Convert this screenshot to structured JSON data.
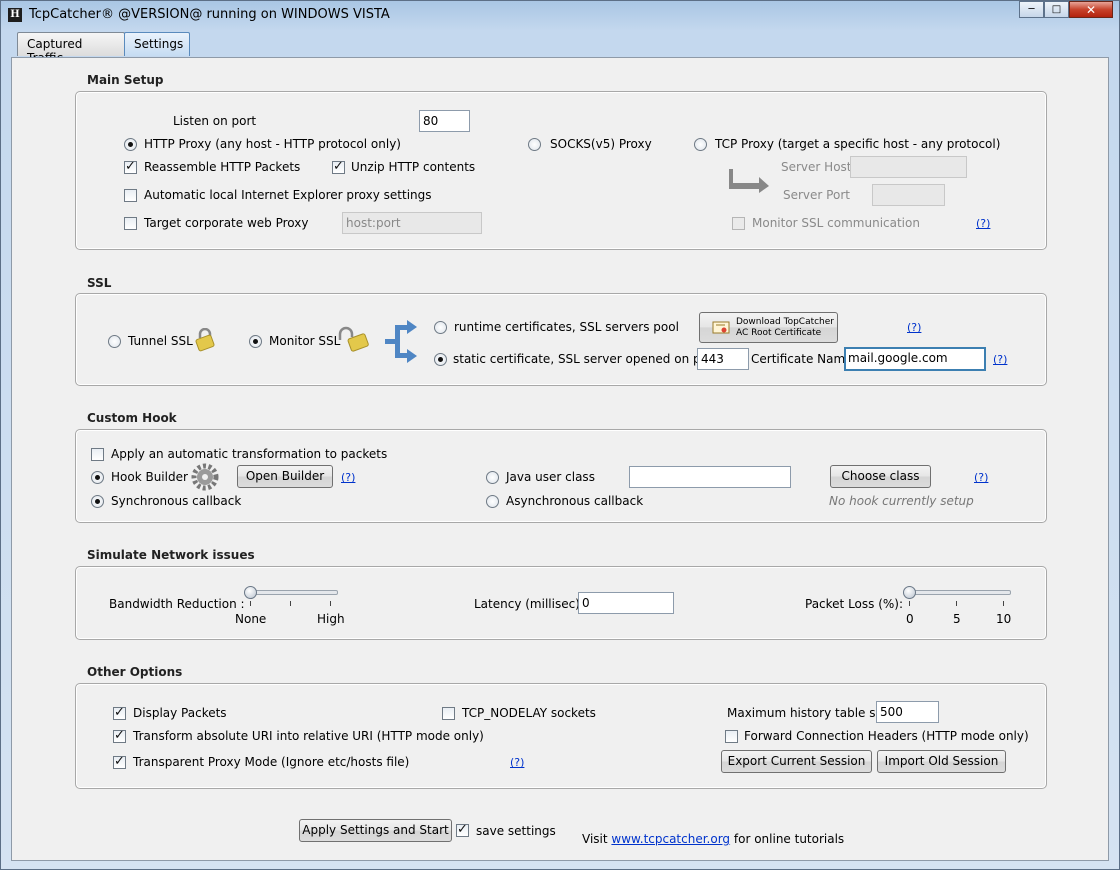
{
  "window": {
    "title": "TcpCatcher®  @VERSION@ running on WINDOWS VISTA"
  },
  "tabs": [
    {
      "label": "Captured Traffic"
    },
    {
      "label": "Settings"
    }
  ],
  "main_setup": {
    "title": "Main Setup",
    "listen_port_label": "Listen on port",
    "listen_port_value": "80",
    "http_proxy_label": "HTTP Proxy (any host - HTTP protocol only)",
    "socks_label": "SOCKS(v5) Proxy",
    "tcp_proxy_label": "TCP Proxy (target a specific host - any protocol)",
    "reassemble_label": "Reassemble HTTP Packets",
    "unzip_label": "Unzip HTTP contents",
    "auto_ie_label": "Automatic local Internet Explorer proxy settings",
    "target_proxy_label": "Target corporate web Proxy",
    "target_proxy_placeholder": "host:port",
    "server_host_label": "Server Host",
    "server_port_label": "Server Port",
    "monitor_ssl_label": "Monitor SSL communication",
    "help": "(?)"
  },
  "ssl": {
    "title": "SSL",
    "tunnel_label": "Tunnel SSL",
    "monitor_label": "Monitor SSL",
    "runtime_label": "runtime certificates, SSL servers pool",
    "static_label": "static certificate, SSL server opened on port:",
    "port_value": "443",
    "cert_name_label": "Certificate Name",
    "cert_name_value": "mail.google.com",
    "download_line1": "Download TopCatcher",
    "download_line2": "AC Root Certificate",
    "help": "(?)"
  },
  "custom_hook": {
    "title": "Custom Hook",
    "apply_label": "Apply an automatic transformation to packets",
    "hook_builder_label": "Hook Builder",
    "open_builder": "Open Builder",
    "java_user_class_label": "Java user class",
    "choose_class": "Choose class",
    "sync_label": "Synchronous callback",
    "async_label": "Asynchronous callback",
    "no_hook": "No hook currently setup",
    "help": "(?)"
  },
  "network": {
    "title": "Simulate Network issues",
    "bandwidth_label": "Bandwidth Reduction :",
    "bandwidth_min": "None",
    "bandwidth_max": "High",
    "bandwidth_level": 0,
    "latency_label": "Latency (millisec):",
    "latency_value": "0",
    "packet_loss_label": "Packet Loss (%):",
    "packet_loss_ticks": [
      "0",
      "5",
      "10"
    ],
    "packet_loss_value": 0
  },
  "other": {
    "title": "Other Options",
    "display_packets": "Display Packets",
    "tcp_nodelay": "TCP_NODELAY sockets",
    "max_history_label": "Maximum history table size",
    "max_history_value": "500",
    "transform_uri": "Transform absolute URI into relative URI (HTTP mode only)",
    "forward_headers": "Forward Connection Headers (HTTP mode only)",
    "transparent_proxy": "Transparent Proxy Mode (Ignore etc/hosts file)",
    "export_session": "Export Current Session",
    "import_session": "Import Old Session",
    "help": "(?)"
  },
  "footer": {
    "apply_button": "Apply Settings and Start",
    "save_settings": "save settings",
    "visit_prefix": "Visit",
    "visit_link": "www.tcpcatcher.org",
    "visit_suffix": "for online tutorials"
  }
}
